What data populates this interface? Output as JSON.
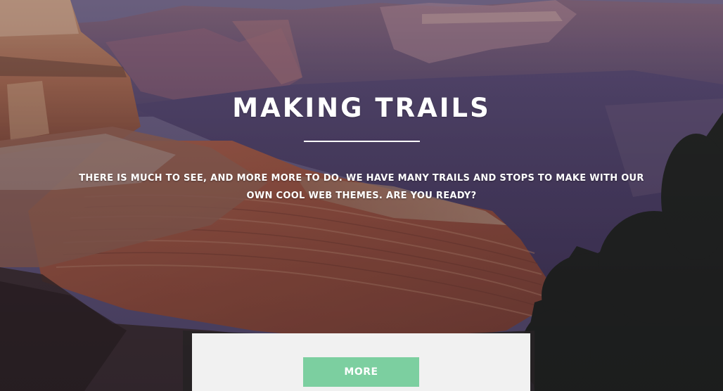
{
  "hero": {
    "title": "MAKING TRAILS",
    "tagline": "THERE IS MUCH TO SEE, AND MORE MORE TO DO. WE HAVE MANY TRAILS AND STOPS TO MAKE WITH OUR OWN COOL WEB THEMES. ARE YOU READY?"
  },
  "panel": {
    "more_label": "MORE"
  },
  "colors": {
    "button": "#7ccfa0",
    "text": "#ffffff",
    "panel": "#f8f8f8"
  }
}
